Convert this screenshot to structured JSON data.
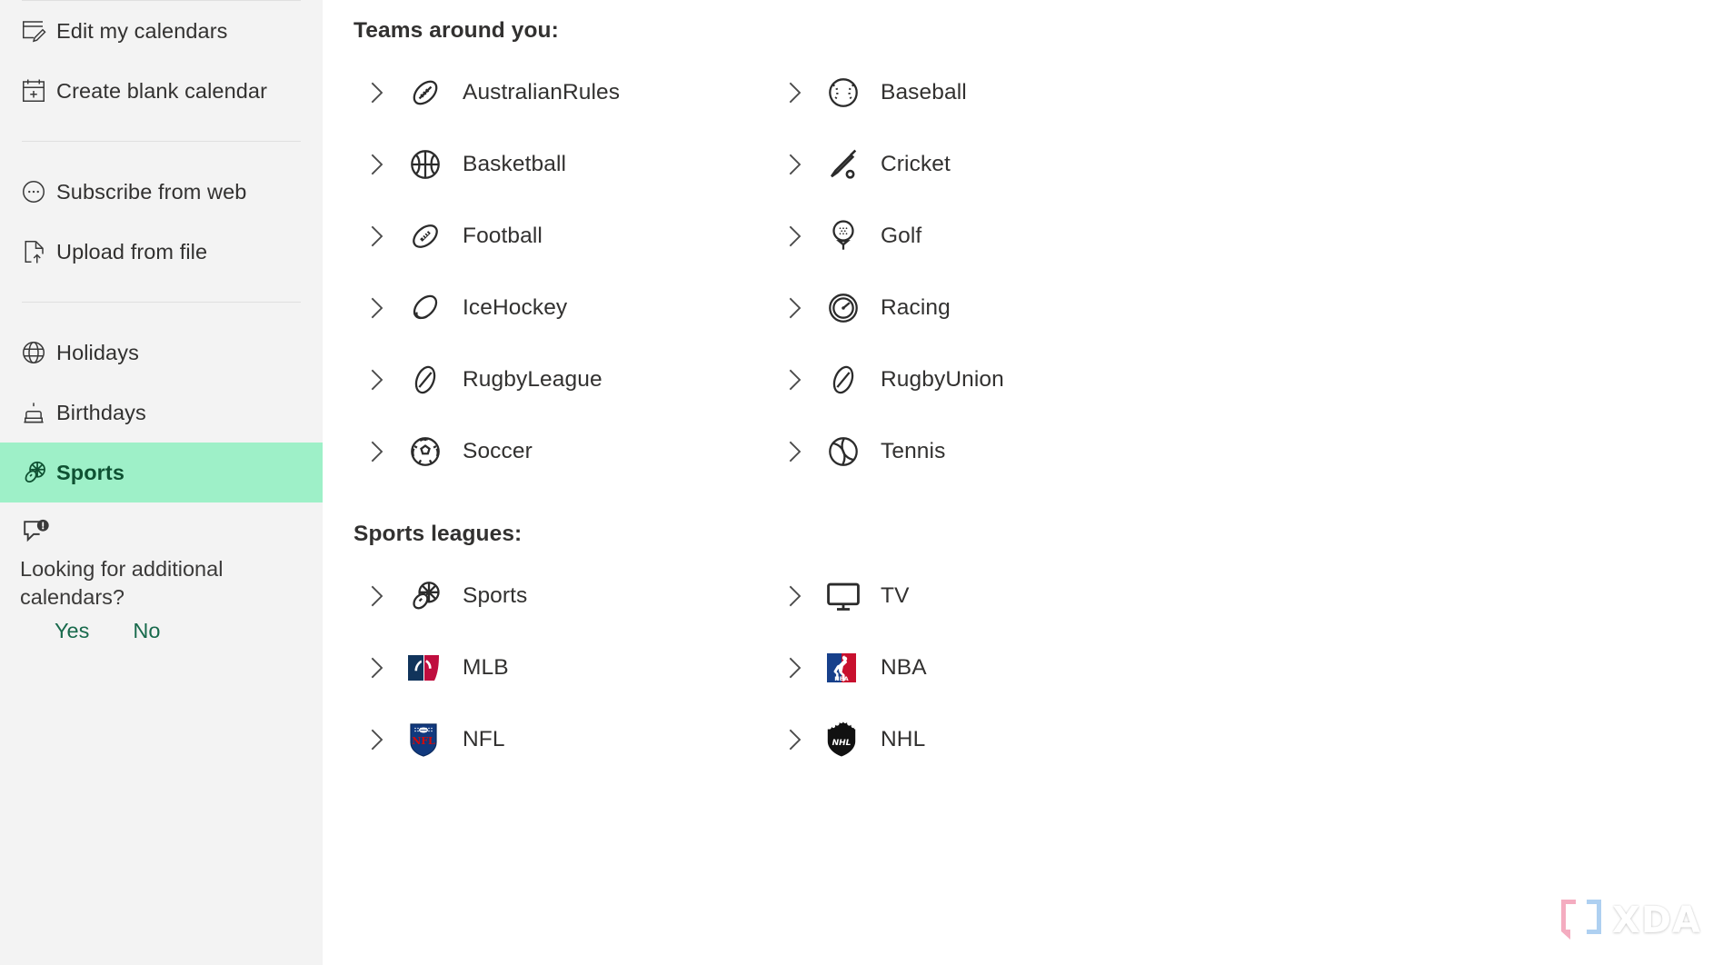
{
  "sidebar": {
    "items": [
      {
        "label": "Edit my calendars",
        "icon": "calendar-edit-icon",
        "active": false
      },
      {
        "label": "Create blank calendar",
        "icon": "calendar-add-icon",
        "active": false
      },
      {
        "label": "Subscribe from web",
        "icon": "subscribe-web-icon",
        "active": false
      },
      {
        "label": "Upload from file",
        "icon": "upload-file-icon",
        "active": false
      },
      {
        "label": "Holidays",
        "icon": "globe-icon",
        "active": false
      },
      {
        "label": "Birthdays",
        "icon": "cake-icon",
        "active": false
      },
      {
        "label": "Sports",
        "icon": "sports-balls-icon",
        "active": true
      }
    ],
    "feedback": {
      "icon": "feedback-alert-icon",
      "question": "Looking for additional calendars?",
      "yes_label": "Yes",
      "no_label": "No"
    },
    "highlight_color": "#9ef0c8",
    "highlight_text_color": "#0f5132",
    "link_color": "#186a4c",
    "background": "#f3f3f3"
  },
  "main": {
    "teams_title": "Teams around you:",
    "teams": [
      {
        "label": "AustralianRules",
        "icon": "australian-football-icon"
      },
      {
        "label": "Baseball",
        "icon": "baseball-icon"
      },
      {
        "label": "Basketball",
        "icon": "basketball-icon"
      },
      {
        "label": "Cricket",
        "icon": "cricket-bat-icon"
      },
      {
        "label": "Football",
        "icon": "american-football-icon"
      },
      {
        "label": "Golf",
        "icon": "golf-ball-tee-icon"
      },
      {
        "label": "IceHockey",
        "icon": "hockey-puck-icon"
      },
      {
        "label": "Racing",
        "icon": "speedometer-icon"
      },
      {
        "label": "RugbyLeague",
        "icon": "rugby-ball-icon"
      },
      {
        "label": "RugbyUnion",
        "icon": "rugby-ball-icon"
      },
      {
        "label": "Soccer",
        "icon": "soccer-ball-icon"
      },
      {
        "label": "Tennis",
        "icon": "tennis-ball-icon"
      }
    ],
    "leagues_title": "Sports leagues:",
    "leagues": [
      {
        "label": "Sports",
        "icon": "sports-balls-icon"
      },
      {
        "label": "TV",
        "icon": "monitor-icon"
      },
      {
        "label": "MLB",
        "icon": "mlb-logo-icon"
      },
      {
        "label": "NBA",
        "icon": "nba-logo-icon"
      },
      {
        "label": "NFL",
        "icon": "nfl-logo-icon"
      },
      {
        "label": "NHL",
        "icon": "nhl-logo-icon"
      }
    ],
    "expand_icon": "chevron-right-icon"
  },
  "watermark": {
    "text": "XDA",
    "icon": "xda-bracket-logo-icon"
  }
}
